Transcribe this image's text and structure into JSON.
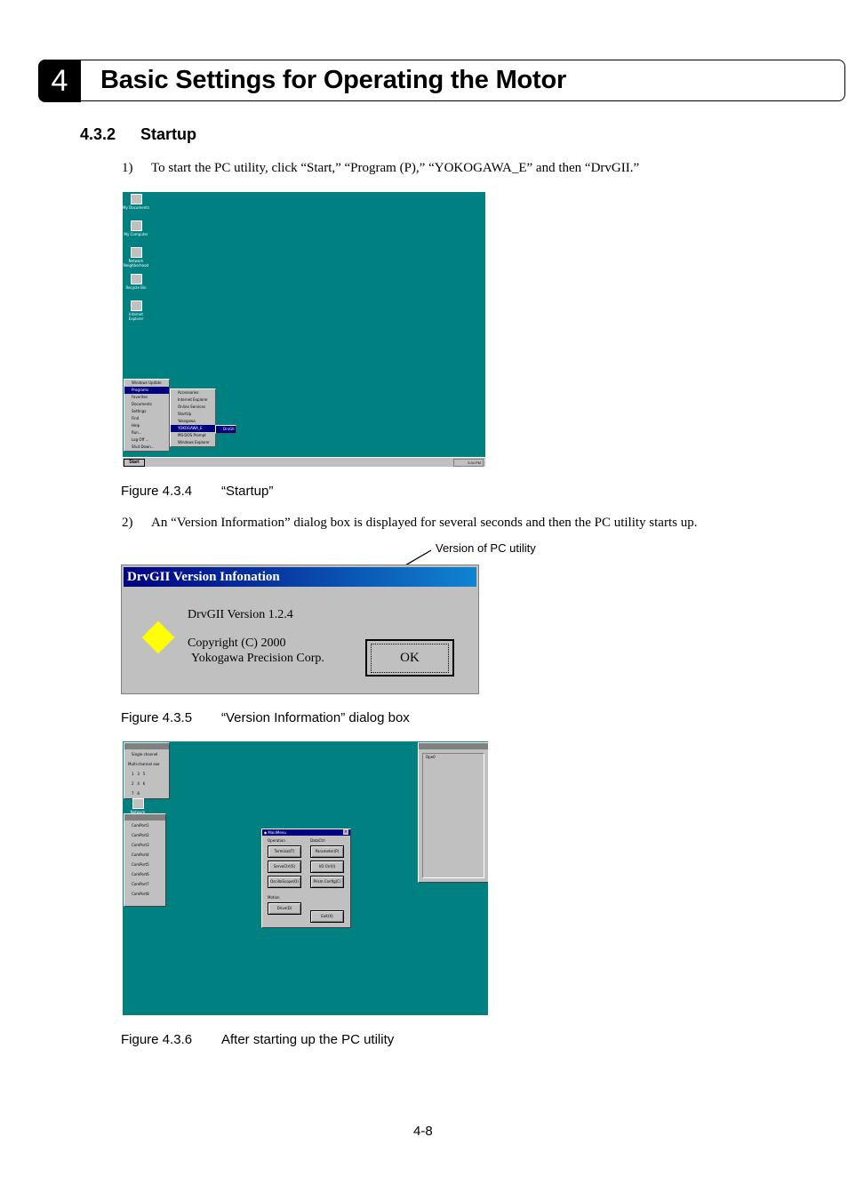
{
  "chapter": {
    "number": "4",
    "title": "Basic Settings for Operating the Motor"
  },
  "section": {
    "number": "4.3.2",
    "title": "Startup"
  },
  "steps": [
    {
      "num": "1)",
      "text": "To start the PC utility, click “Start,” “Program (P),” “YOKOGAWA_E” and then “DrvGII.”"
    },
    {
      "num": "2)",
      "text": "An “Version Information” dialog box is displayed for several seconds and then the PC utility starts up."
    }
  ],
  "figures": [
    {
      "label": "Figure 4.3.4",
      "caption": "“Startup”"
    },
    {
      "label": "Figure 4.3.5",
      "caption": "“Version Information” dialog box"
    },
    {
      "label": "Figure 4.3.6",
      "caption": "After starting up the PC utility"
    }
  ],
  "desktop": {
    "icons": [
      "My Documents",
      "My Computer",
      "Network Neighborhood",
      "Recycle Bin",
      "Internet Explorer"
    ],
    "start_menu": [
      "Windows Update",
      "Programs",
      "Favorites",
      "Documents",
      "Settings",
      "Find",
      "Help",
      "Run...",
      "Log Off ...",
      "Shut Down..."
    ],
    "programs_menu": [
      "Accessories",
      "Internet Explorer",
      "Online Services",
      "StartUp",
      "Yokogawa",
      "YOKOGAWA_E",
      "MS-DOS Prompt",
      "Windows Explorer"
    ],
    "yokogawa_menu": [
      "DrvGII"
    ],
    "start_label": "Start",
    "clock": "3:34 PM"
  },
  "dialog": {
    "title": "DrvGII Version Infonation",
    "version": "DrvGII Version 1.2.4",
    "copyright": "Copyright (C) 2000",
    "company": "Yokogawa Precision Corp.",
    "ok_label": "OK",
    "annotation": "Version of PC utility",
    "icon_color": "#ffff00"
  },
  "app": {
    "left_panel_top": [
      "Single channel",
      "Multi-channel exe",
      "1",
      "2",
      "3",
      "4",
      "5",
      "6",
      "7",
      "8"
    ],
    "left_panel_ports": [
      "ComPort1",
      "ComPort2",
      "ComPort3",
      "ComPort4",
      "ComPort5",
      "ComPort6",
      "ComPort7",
      "ComPort8"
    ],
    "main_title": "MainMenu",
    "operation_label": "Operation",
    "datactrl_label": "DataCtrl",
    "buttons_left": [
      "Terminal(T)",
      "ServoCtrl(S)",
      "OscilloScope(O)"
    ],
    "buttons_right": [
      "Parameter(P)",
      "I/O Ctrl(I)",
      "Prism Config(C)"
    ],
    "motion_label": "Motion",
    "drive_button": "Drive(D)",
    "exit_button": "Exit(X)",
    "right_list_item": "Ope0"
  },
  "page_number": "4-8",
  "colors": {
    "desktop": "#008080",
    "titlebar": "#000080",
    "window": "#c0c0c0"
  }
}
